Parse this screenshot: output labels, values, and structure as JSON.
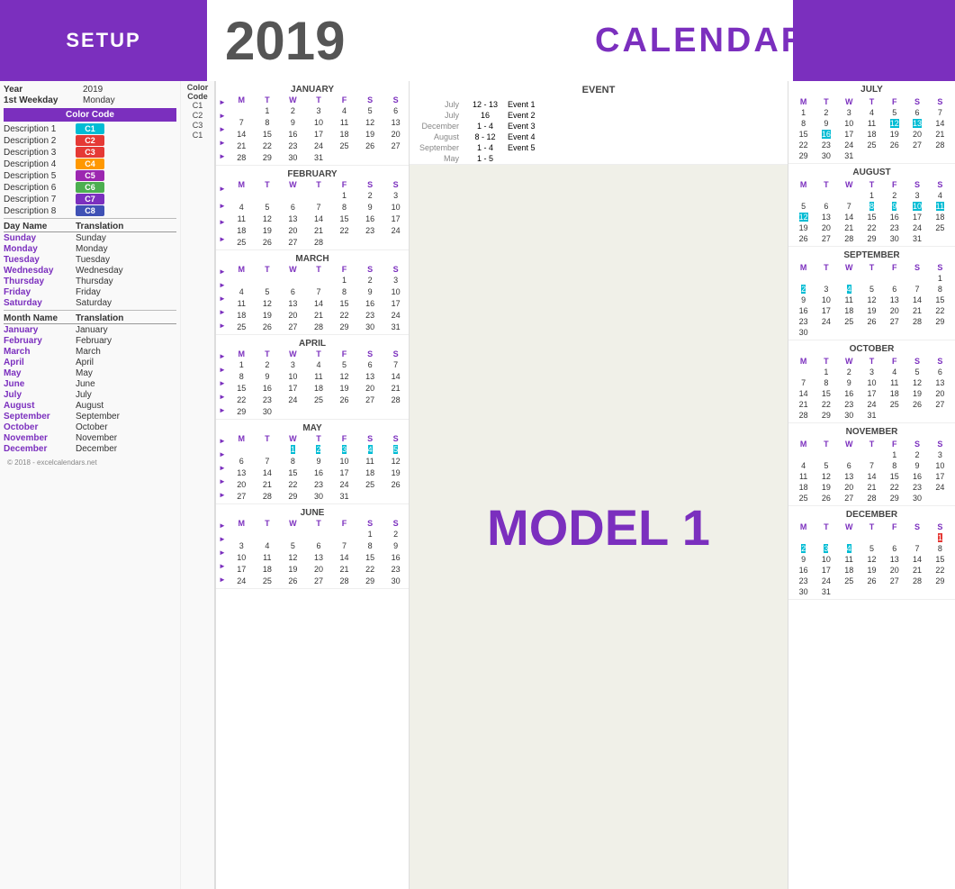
{
  "header": {
    "setup_label": "SETUP",
    "year": "2019",
    "calendar_label": "CALENDAR"
  },
  "sidebar": {
    "year_label": "Year",
    "year_value": "2019",
    "weekday_label": "1st Weekday",
    "weekday_value": "Monday",
    "color_code_title": "Color Code",
    "color_codes": [
      {
        "desc": "Description 1",
        "code": "C1",
        "color": "#00bcd4"
      },
      {
        "desc": "Description 2",
        "code": "C2",
        "color": "#e53935"
      },
      {
        "desc": "Description 3",
        "code": "C3",
        "color": "#e53935"
      },
      {
        "desc": "Description 4",
        "code": "C4",
        "color": "#ff9800"
      },
      {
        "desc": "Description 5",
        "code": "C5",
        "color": "#7b2fbe"
      },
      {
        "desc": "Description 6",
        "code": "C6",
        "color": "#4caf50"
      },
      {
        "desc": "Description 7",
        "code": "C7",
        "color": "#7b2fbe"
      },
      {
        "desc": "Description 8",
        "code": "C8",
        "color": "#3f51b5"
      }
    ],
    "color_col_items": [
      "Color",
      "Code",
      "C1",
      "C2",
      "C3",
      "C1",
      "",
      "",
      "",
      ""
    ],
    "day_name_label": "Day Name",
    "translation_label": "Translation",
    "days": [
      {
        "name": "Sunday",
        "trans": "Sunday"
      },
      {
        "name": "Monday",
        "trans": "Monday"
      },
      {
        "name": "Tuesday",
        "trans": "Tuesday"
      },
      {
        "name": "Wednesday",
        "trans": "Wednesday"
      },
      {
        "name": "Thursday",
        "trans": "Thursday"
      },
      {
        "name": "Friday",
        "trans": "Friday"
      },
      {
        "name": "Saturday",
        "trans": "Saturday"
      }
    ],
    "month_name_label": "Month Name",
    "months": [
      {
        "name": "January",
        "trans": "January"
      },
      {
        "name": "February",
        "trans": "February"
      },
      {
        "name": "March",
        "trans": "March"
      },
      {
        "name": "April",
        "trans": "April"
      },
      {
        "name": "May",
        "trans": "May"
      },
      {
        "name": "June",
        "trans": "June"
      },
      {
        "name": "July",
        "trans": "July"
      },
      {
        "name": "August",
        "trans": "August"
      },
      {
        "name": "September",
        "trans": "September"
      },
      {
        "name": "October",
        "trans": "October"
      },
      {
        "name": "November",
        "trans": "November"
      },
      {
        "name": "December",
        "trans": "December"
      }
    ]
  },
  "events": [
    {
      "month": "July",
      "dates": "12 - 13",
      "name": "Event 1"
    },
    {
      "month": "July",
      "dates": "16",
      "name": "Event 2"
    },
    {
      "month": "December",
      "dates": "1 - 4",
      "name": "Event 3"
    },
    {
      "month": "August",
      "dates": "8 - 12",
      "name": "Event 4"
    },
    {
      "month": "September",
      "dates": "1 - 4",
      "name": "Event 5"
    },
    {
      "month": "May",
      "dates": "1 - 5",
      "name": ""
    }
  ],
  "model_label": "MODEL 1",
  "footer_text": "© 2018 - excelcalendars.net"
}
